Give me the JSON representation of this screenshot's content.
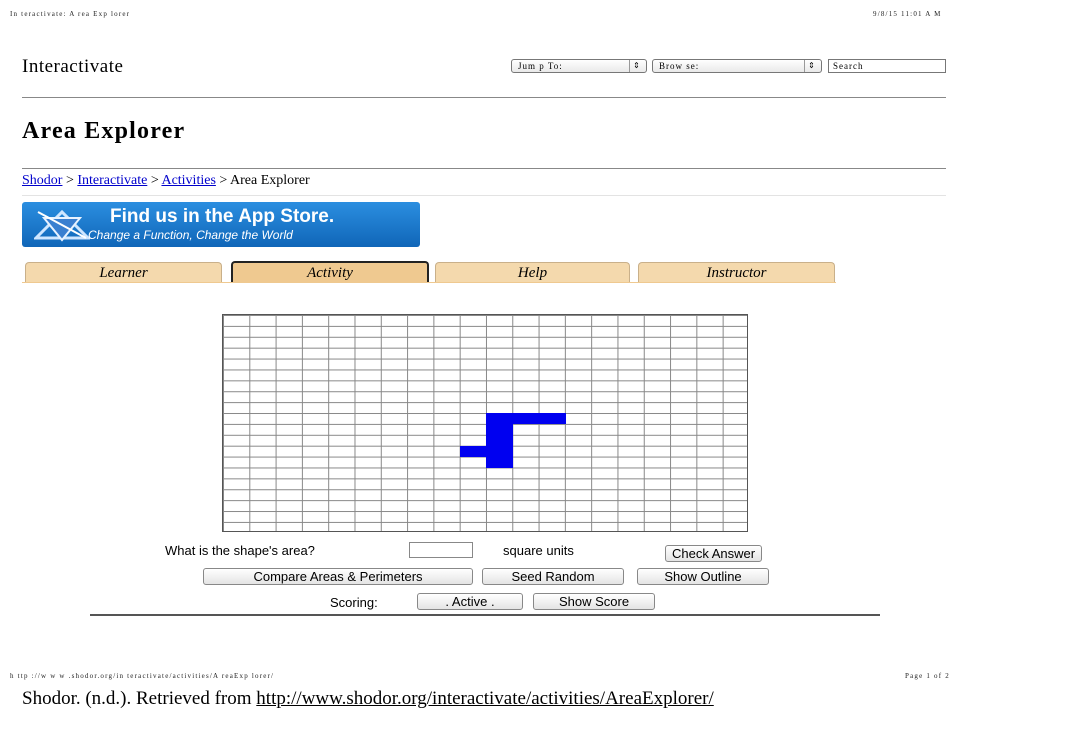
{
  "print_header": {
    "left": "In teractivate: A rea Exp lorer",
    "right": "9/8/15 11:01 A M"
  },
  "site": {
    "name": "Interactivate"
  },
  "nav": {
    "jump_to": "Jum p To:",
    "browse": "Brow se:",
    "search": "Search"
  },
  "page_title": "Area Explorer",
  "breadcrumb": {
    "items": [
      "Shodor",
      "Interactivate",
      "Activities"
    ],
    "separator": ">",
    "current": "Area Explorer"
  },
  "banner": {
    "line1": "Find us in the App Store.",
    "line2": "Change a Function, Change the World"
  },
  "tabs": [
    {
      "label": "Learner",
      "active": false
    },
    {
      "label": "Activity",
      "active": true
    },
    {
      "label": "Help",
      "active": false
    },
    {
      "label": "Instructor",
      "active": false
    }
  ],
  "shape": {
    "color": "#0000f0",
    "filled_cells": [
      [
        10,
        9
      ],
      [
        11,
        9
      ],
      [
        12,
        9
      ],
      [
        10,
        10
      ],
      [
        10,
        11
      ],
      [
        9,
        12
      ],
      [
        10,
        12
      ],
      [
        10,
        13
      ]
    ],
    "grid_size": [
      20,
      20
    ]
  },
  "question": {
    "label": "What is the shape's area?",
    "input_value": "",
    "units": "square units",
    "check_button": "Check Answer"
  },
  "buttons": {
    "compare": "Compare Areas & Perimeters",
    "seed_random": "Seed Random",
    "show_outline": "Show Outline"
  },
  "scoring": {
    "label": "Scoring:",
    "active_button": ". Active .",
    "show_score": "Show Score"
  },
  "print_footer": {
    "url": "h ttp ://w w w .shodor.org/in teractivate/activities/A reaExp lorer/",
    "page": "Page 1 of 2"
  },
  "citation": {
    "prefix": "Shodor. (n.d.). Retrieved from ",
    "link": "http://www.shodor.org/interactivate/activities/AreaExplorer/"
  }
}
